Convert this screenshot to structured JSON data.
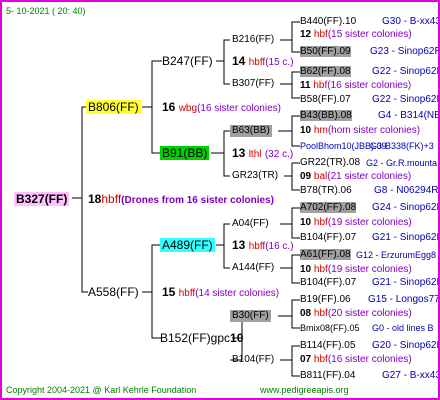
{
  "header": {
    "date_text": "5- 10-2021 ( 20: 40)"
  },
  "footer": {
    "copyright": "Copyright 2004-2021 @ Karl Kehrle Foundation",
    "site": "www.pedigreeapis.org"
  },
  "colors": {
    "frame": "#e000e0",
    "yellow": "#ffff33",
    "green": "#00d000",
    "cyan": "#33ffff",
    "grey": "#a0a0a0",
    "pink": "#ffc0ff",
    "red": "#d00000",
    "purple": "#8000c0",
    "navy": "#0000b0"
  },
  "gen0": {
    "id": "B327(FF)",
    "num": "18",
    "code": "hbff",
    "note": "(Drones from 16 sister colonies)"
  },
  "gen1": [
    {
      "id": "B806(FF)",
      "num": "16",
      "code": "wbg",
      "note": "(16 sister colonies)"
    },
    {
      "id": "A558(FF)",
      "num": "15",
      "code": "hbff",
      "note": "(14 sister colonies)"
    }
  ],
  "gen2": [
    {
      "id": "B247(FF)",
      "num": "14",
      "code": "hbff",
      "note": "(15 c.)"
    },
    {
      "id": "B91(BB)",
      "num": "13",
      "code": "lthl",
      "note": "(32 c.)"
    },
    {
      "id": "A489(FF)",
      "num": "13",
      "code": "hbff",
      "note": "(16 c.)"
    },
    {
      "id": "B152(FF)gpc",
      "num": "10",
      "code": "",
      "note": ""
    }
  ],
  "gen3": [
    {
      "id": "B216(FF)"
    },
    {
      "id": "B307(FF)"
    },
    {
      "id": "B63(BB)"
    },
    {
      "id": "GR23(TR)"
    },
    {
      "id": "A04(FF)"
    },
    {
      "id": "A144(FF)"
    },
    {
      "id": "B30(FF)"
    },
    {
      "id": "B104(FF)"
    }
  ],
  "gen4": [
    {
      "id": "B440(FF).10",
      "src": "G30 - B-xx43"
    },
    {
      "num": "12",
      "code": "hbf",
      "note": "(15 sister colonies)"
    },
    {
      "id": "B50(FF).09",
      "src": "G23 - Sinop62R"
    },
    {
      "id": "B62(FF).08",
      "src": "G22 - Sinop62R"
    },
    {
      "num": "11",
      "code": "hbf",
      "note": "(16 sister colonies)"
    },
    {
      "id": "B58(FF).07",
      "src": "G22 - Sinop62R"
    },
    {
      "id": "B43(BB).08",
      "src": "G4 - B314(NE)"
    },
    {
      "num": "10",
      "code": "hm",
      "note": "(hom sister colonies)"
    },
    {
      "id": "PoolBhom10(JBB).09",
      "src": "G3-B338(FK)+3"
    },
    {
      "id": "GR22(TR).08",
      "src": "G2 - Gr.R.mounta"
    },
    {
      "num": "09",
      "code": "bal",
      "note": "(21 sister colonies)"
    },
    {
      "id": "B78(TR).06",
      "src": "G8 - N06294R"
    },
    {
      "id": "A702(FF).08",
      "src": "G24 - Sinop62R"
    },
    {
      "num": "10",
      "code": "hbf",
      "note": "(19 sister colonies)"
    },
    {
      "id": "B104(FF).07",
      "src": "G21 - Sinop62R"
    },
    {
      "id": "A61(FF).08",
      "src": "G12 - ErzurumEgg8"
    },
    {
      "num": "10",
      "code": "hbf",
      "note": "(19 sister colonies)"
    },
    {
      "id": "B104(FF).07",
      "src": "G21 - Sinop62R"
    },
    {
      "id": "B19(FF).06",
      "src": "G15 - Longos77R"
    },
    {
      "num": "08",
      "code": "hbf",
      "note": "(20 sister colonies)"
    },
    {
      "id": "Bmix08(FF).05",
      "src": "G0 - old lines B"
    },
    {
      "id": "B114(FF).05",
      "src": "G20 - Sinop62R"
    },
    {
      "num": "07",
      "code": "hbf",
      "note": "(16 sister colonies)"
    },
    {
      "id": "B811(FF).04",
      "src": "G27 - B-xx43"
    }
  ]
}
